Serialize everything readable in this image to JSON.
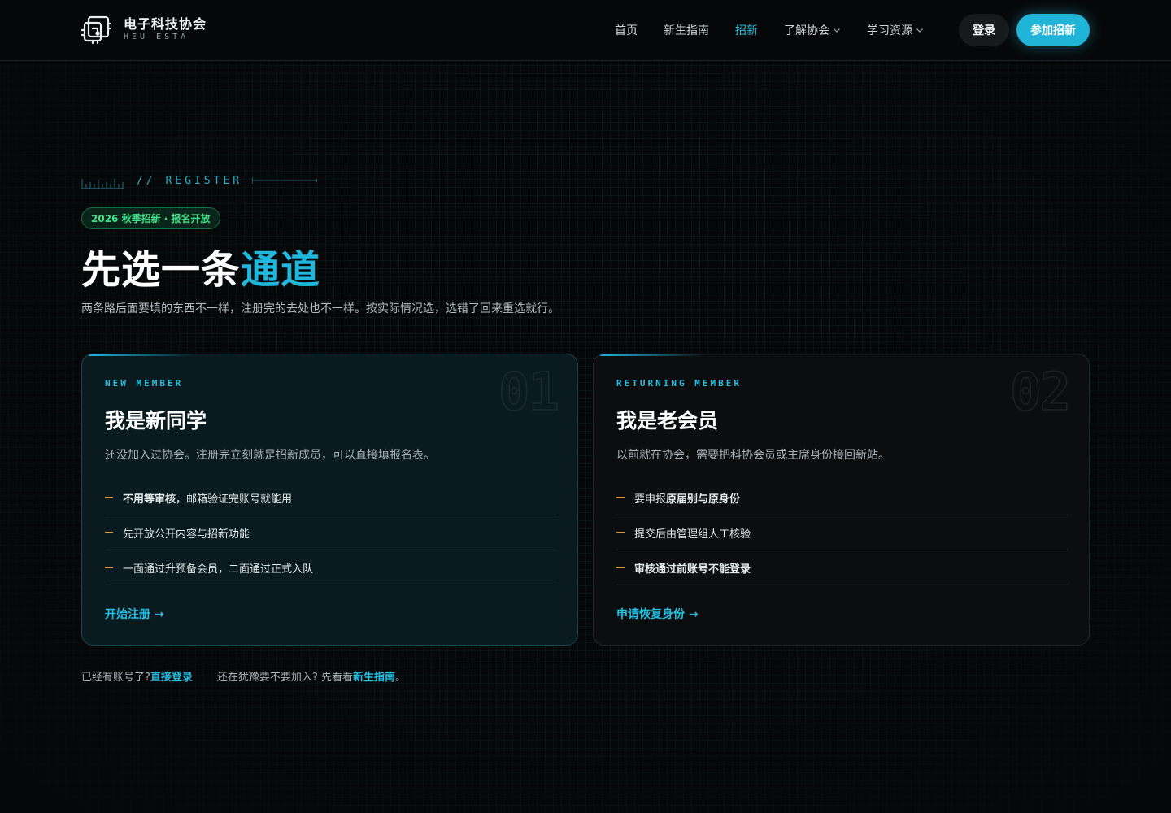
{
  "nav": {
    "brand_name": "电子科技协会",
    "brand_sub": "HEU ESTA",
    "links": [
      {
        "label": "首页"
      },
      {
        "label": "新生指南"
      },
      {
        "label": "招新"
      },
      {
        "label": "了解协会"
      },
      {
        "label": "学习资源"
      }
    ],
    "active_index": 2,
    "login_label": "登录",
    "join_label": "参加招新"
  },
  "hero": {
    "eyebrow": "// REGISTER",
    "badge": "2026 秋季招新 · 报名开放",
    "title_main": "先选一条",
    "title_highlight": "通道",
    "description": "两条路后面要填的东西不一样，注册完的去处也不一样。按实际情况选，选错了回来重选就行。"
  },
  "cards": [
    {
      "number": "01",
      "kicker": "NEW MEMBER",
      "title": "我是新同学",
      "description": "还没加入过协会。注册完立刻就是招新成员，可以直接填报名表。",
      "items": [
        {
          "bold": "不用等审核",
          "text": "，邮箱验证完账号就能用"
        },
        {
          "bold": "",
          "text": "先开放公开内容与招新功能"
        },
        {
          "bold": "",
          "text": "一面通过升预备会员，二面通过正式入队"
        }
      ],
      "cta": "开始注册 →"
    },
    {
      "number": "02",
      "kicker": "RETURNING MEMBER",
      "title": "我是老会员",
      "description": "以前就在协会，需要把科协会员或主席身份接回新站。",
      "items": [
        {
          "pre": "要申报",
          "bold": "原届别与原身份",
          "text": ""
        },
        {
          "pre": "",
          "bold": "",
          "text": "提交后由管理组人工核验"
        },
        {
          "pre": "",
          "bold": "审核通过前账号不能登录",
          "text": ""
        }
      ],
      "cta": "申请恢复身份 →"
    }
  ],
  "footer": {
    "prompt1": "已经有账号了?",
    "link1": "直接登录",
    "prompt2": "还在犹豫要不要加入? 先看看",
    "link2": "新生指南",
    "suffix2": "。"
  },
  "colors": {
    "accent": "#1fb4d8",
    "badge_green": "#3fe28b",
    "dash_orange": "#e0982c",
    "background": "#050708"
  },
  "icons": [
    "circuit-logo-icon",
    "chevron-down-icon",
    "ticks-icon",
    "arrow-right-icon"
  ]
}
